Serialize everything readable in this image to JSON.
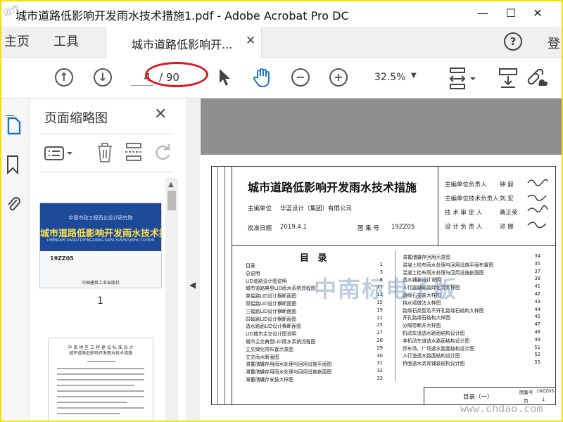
{
  "window": {
    "title": "城市道路低影响开发雨水技术措施1.pdf - Adobe Acrobat Pro DC",
    "minimize": "—",
    "maximize": "☐",
    "close": "✕"
  },
  "tabs": {
    "home": "主页",
    "tools": "工具",
    "doc_tab": "城市道路低影响开...",
    "doc_close": "✕",
    "help": "?",
    "login": "登"
  },
  "toolbar": {
    "page_current": "4",
    "page_total": "/ 90",
    "zoom": "32.5%"
  },
  "panel": {
    "title": "页面缩略图",
    "close": "✕",
    "thumb1_number": "1"
  },
  "thumb1": {
    "header": "中国市政工程西北设计研究院",
    "title": "城市道路低影响开发雨水技术措施",
    "pinyin": "CHENGSHI DAOLU DIYINGXIANG KAIFA YUSHUI JISHU CUOSHI",
    "code": "19ZZ05",
    "publisher": "中国建筑工业出版社"
  },
  "thumb2": {
    "header": "中 南 地 区 工 程 建 设 标 准 设 计",
    "title": "城市道路低影响开发雨水技术措施"
  },
  "doc": {
    "title": "城市道路低影响开发雨水技术措施",
    "org_label": "主编单位",
    "org_value": "华蓝设计（集团）有限公司",
    "date_label": "批准日期",
    "date_value": "2019.4.1",
    "atlas_label": "图 集 号",
    "atlas_value": "19ZZ05",
    "roles": [
      {
        "role": "主编单位负责人",
        "name": "钟 毅"
      },
      {
        "role": "主编单位技术负责人",
        "name": "刘 宏"
      },
      {
        "role": "技 术 审 定 人",
        "name": "黄正荣"
      },
      {
        "role": "设 计 负 责 人",
        "name": "邓 娜"
      }
    ],
    "contents_title": "目 录",
    "toc_left": [
      {
        "t": "目录",
        "p": "1"
      },
      {
        "t": "总说明",
        "p": "3"
      },
      {
        "t": "LID道路设计图说明",
        "p": "8"
      },
      {
        "t": "城市道路典型LID雨水系统流程图",
        "p": "11"
      },
      {
        "t": "单幅路LID设计横断面图",
        "p": "12"
      },
      {
        "t": "双幅路LID设计横断面图",
        "p": "15"
      },
      {
        "t": "三幅路LID设计横断面图",
        "p": "19"
      },
      {
        "t": "四幅路LID设计横断面图",
        "p": "21"
      },
      {
        "t": "透水路面LID设计横断面图",
        "p": "25"
      },
      {
        "t": "LID城市主交设计图说明",
        "p": "27"
      },
      {
        "t": "城市主交典型LID雨水系统流程图",
        "p": "28"
      },
      {
        "t": "立交绿化带布置示意图",
        "p": "29"
      },
      {
        "t": "立交雨水断面图",
        "p": "30"
      },
      {
        "t": "滞蓄储罐存用雨水处理与回用设施平面图",
        "p": "31"
      },
      {
        "t": "滞蓄储罐存用雨水处理与回用设施剖面图",
        "p": "32"
      },
      {
        "t": "滞蓄储罐存安装大样图",
        "p": "33"
      }
    ],
    "toc_right": [
      {
        "t": "滞蓄储罐存回用示意图",
        "p": "34"
      },
      {
        "t": "混凝土检布雨水处理与回用设施平面布置图",
        "p": "35"
      },
      {
        "t": "混凝土检布雨水处理与回用设施剖面图",
        "p": "37"
      },
      {
        "t": "透水铺装设计说明",
        "p": "38"
      },
      {
        "t": "人行道铺砌及绿化带大样图",
        "p": "41"
      },
      {
        "t": "路缘石安装大样图",
        "p": "42"
      },
      {
        "t": "挡水墙做法大样图",
        "p": "43"
      },
      {
        "t": "路缘石类型及不开孔路缘石结构大样图",
        "p": "44"
      },
      {
        "t": "开孔路缘石结构大样图",
        "p": "45"
      },
      {
        "t": "分隔带断开大样图",
        "p": "47"
      },
      {
        "t": "机动车道透水路面结构设计图",
        "p": "48"
      },
      {
        "t": "非机动车道透水路面结构设计图",
        "p": "49"
      },
      {
        "t": "停车场、广场透水路面结构设计图",
        "p": "51"
      },
      {
        "t": "人行道透水路面结构设计图",
        "p": "52"
      },
      {
        "t": "桥面透水沥青铺装结构设计图",
        "p": "55"
      }
    ],
    "foot_label": "目录（一）",
    "foot_code_label": "图集号",
    "foot_code": "19ZZ05",
    "foot_page_label": "页",
    "foot_page": "1"
  },
  "watermark": {
    "main": "中南标电子版",
    "site": "www.chdao.com"
  },
  "icons": {
    "prev": "up-circle",
    "next": "down-circle",
    "cursor": "select-arrow",
    "hand": "hand-tool",
    "zoomout": "minus-circle",
    "zoomin": "plus-circle"
  }
}
